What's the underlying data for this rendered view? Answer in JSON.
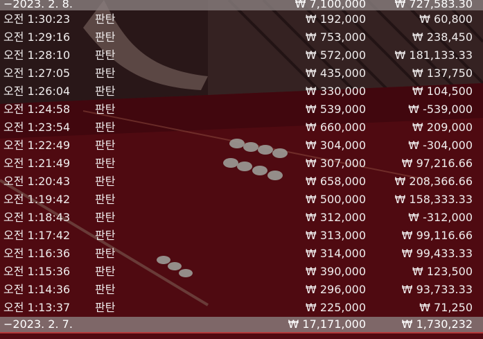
{
  "top_summary": {
    "date": "−2023. 2. 8.",
    "bet_total": "₩ 7,100,000",
    "win_total": "₩ 727,583.30"
  },
  "rows": [
    {
      "time": "오전 1:30:23",
      "game": "판탄",
      "bet": "₩ 192,000",
      "win": "₩ 60,800"
    },
    {
      "time": "오전 1:29:16",
      "game": "판탄",
      "bet": "₩ 753,000",
      "win": "₩ 238,450"
    },
    {
      "time": "오전 1:28:10",
      "game": "판탄",
      "bet": "₩ 572,000",
      "win": "₩ 181,133.33"
    },
    {
      "time": "오전 1:27:05",
      "game": "판탄",
      "bet": "₩ 435,000",
      "win": "₩ 137,750"
    },
    {
      "time": "오전 1:26:04",
      "game": "판탄",
      "bet": "₩ 330,000",
      "win": "₩ 104,500"
    },
    {
      "time": "오전 1:24:58",
      "game": "판탄",
      "bet": "₩ 539,000",
      "win": "₩ -539,000"
    },
    {
      "time": "오전 1:23:54",
      "game": "판탄",
      "bet": "₩ 660,000",
      "win": "₩ 209,000"
    },
    {
      "time": "오전 1:22:49",
      "game": "판탄",
      "bet": "₩ 304,000",
      "win": "₩ -304,000"
    },
    {
      "time": "오전 1:21:49",
      "game": "판탄",
      "bet": "₩ 307,000",
      "win": "₩ 97,216.66"
    },
    {
      "time": "오전 1:20:43",
      "game": "판탄",
      "bet": "₩ 658,000",
      "win": "₩ 208,366.66"
    },
    {
      "time": "오전 1:19:42",
      "game": "판탄",
      "bet": "₩ 500,000",
      "win": "₩ 158,333.33"
    },
    {
      "time": "오전 1:18:43",
      "game": "판탄",
      "bet": "₩ 312,000",
      "win": "₩ -312,000"
    },
    {
      "time": "오전 1:17:42",
      "game": "판탄",
      "bet": "₩ 313,000",
      "win": "₩ 99,116.66"
    },
    {
      "time": "오전 1:16:36",
      "game": "판탄",
      "bet": "₩ 314,000",
      "win": "₩ 99,433.33"
    },
    {
      "time": "오전 1:15:36",
      "game": "판탄",
      "bet": "₩ 390,000",
      "win": "₩ 123,500"
    },
    {
      "time": "오전 1:14:36",
      "game": "판탄",
      "bet": "₩ 296,000",
      "win": "₩ 93,733.33"
    },
    {
      "time": "오전 1:13:37",
      "game": "판탄",
      "bet": "₩ 225,000",
      "win": "₩ 71,250"
    }
  ],
  "bottom_summary": {
    "date": "−2023. 2. 7.",
    "bet_total": "₩ 17,171,000",
    "win_total": "₩ 1,730,232"
  },
  "colors": {
    "text": "#f0eded",
    "summary_row_bg": "#8c8282",
    "accent_underline": "#b53a3a",
    "table_felt": "#6e0f18"
  }
}
